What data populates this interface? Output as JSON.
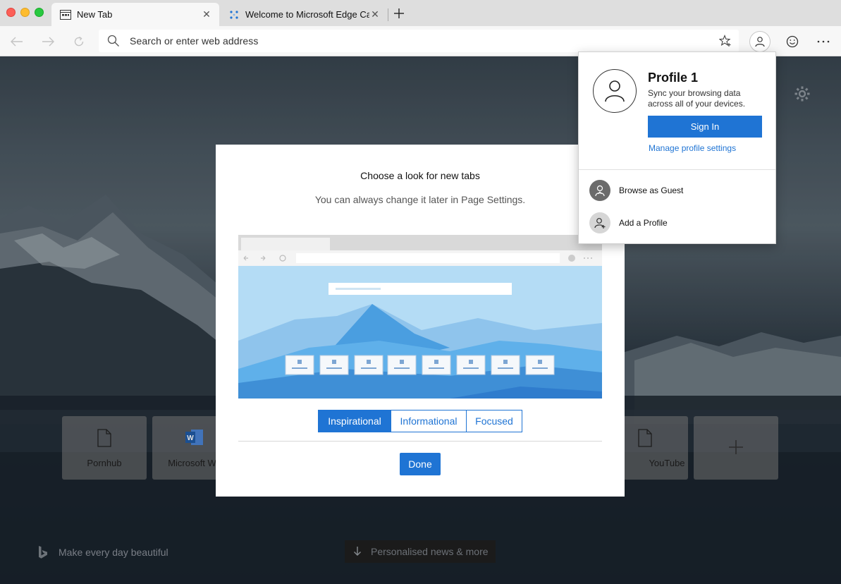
{
  "tabs": [
    {
      "title": "New Tab",
      "active": true,
      "icon": "newtab-icon"
    },
    {
      "title": "Welcome to Microsoft Edge Ca",
      "active": false,
      "icon": "edge-loading-icon"
    }
  ],
  "toolbar": {
    "search_placeholder": "Search or enter web address"
  },
  "new_tab_page": {
    "tiles": [
      {
        "label": "Pornhub",
        "icon": "page-icon"
      },
      {
        "label": "Microsoft Wo",
        "icon": "word-icon"
      },
      {
        "label": "YouTube",
        "icon": "page-icon"
      },
      {
        "label": "",
        "icon": "plus-icon"
      }
    ],
    "tagline": "Make every day beautiful",
    "news_button": "Personalised news & more"
  },
  "modal": {
    "title": "Choose a look for new tabs",
    "subtitle": "You can always change it later in Page Settings.",
    "options": [
      "Inspirational",
      "Informational",
      "Focused"
    ],
    "selected": "Inspirational",
    "done_label": "Done"
  },
  "profile_flyout": {
    "name": "Profile 1",
    "description": "Sync your browsing data across all of your devices.",
    "sign_in_label": "Sign In",
    "manage_label": "Manage profile settings",
    "items": [
      {
        "label": "Browse as Guest",
        "icon": "guest-icon"
      },
      {
        "label": "Add a Profile",
        "icon": "add-profile-icon"
      }
    ]
  },
  "colors": {
    "accent": "#1f74d4",
    "tabbar": "#dedede",
    "toolbar": "#f7f7f7"
  }
}
